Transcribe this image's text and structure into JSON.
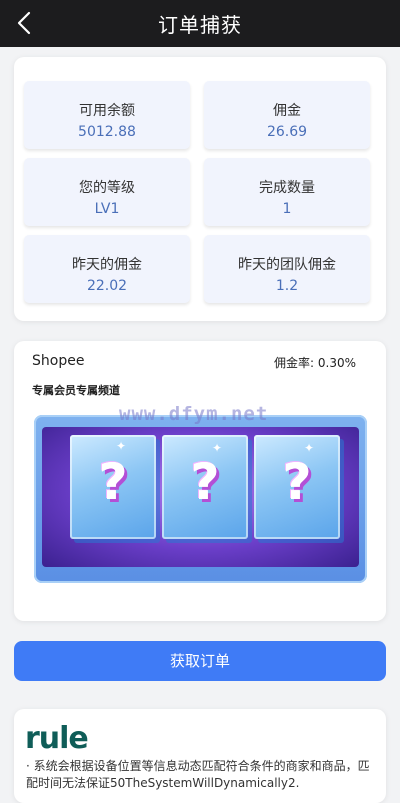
{
  "header": {
    "title": "订单捕获",
    "back_icon": "chevron-left-icon"
  },
  "stats": [
    {
      "label": "可用余额",
      "value": "5012.88"
    },
    {
      "label": "佣金",
      "value": "26.69"
    },
    {
      "label": "您的等级",
      "value": "LV1"
    },
    {
      "label": "完成数量",
      "value": "1"
    },
    {
      "label": "昨天的佣金",
      "value": "22.02"
    },
    {
      "label": "昨天的团队佣金",
      "value": "1.2"
    }
  ],
  "channel": {
    "shop_name": "Shopee",
    "rate_label": "佣金率:",
    "rate_value": "0.30%",
    "title": "专属会员专属频道",
    "watermark": "www.dfym.net",
    "box_symbol": "?"
  },
  "get_order_button": "获取订单",
  "rule": {
    "logo": "rule",
    "text": "· 系统会根据设备位置等信息动态匹配符合条件的商家和商品，匹配时间无法保证50TheSystemWillDynamically2."
  },
  "colors": {
    "header_bg": "#1c1c1e",
    "stat_value": "#4a6fb8",
    "button": "#3f7bf6",
    "rule_logo": "#0f5d58"
  }
}
